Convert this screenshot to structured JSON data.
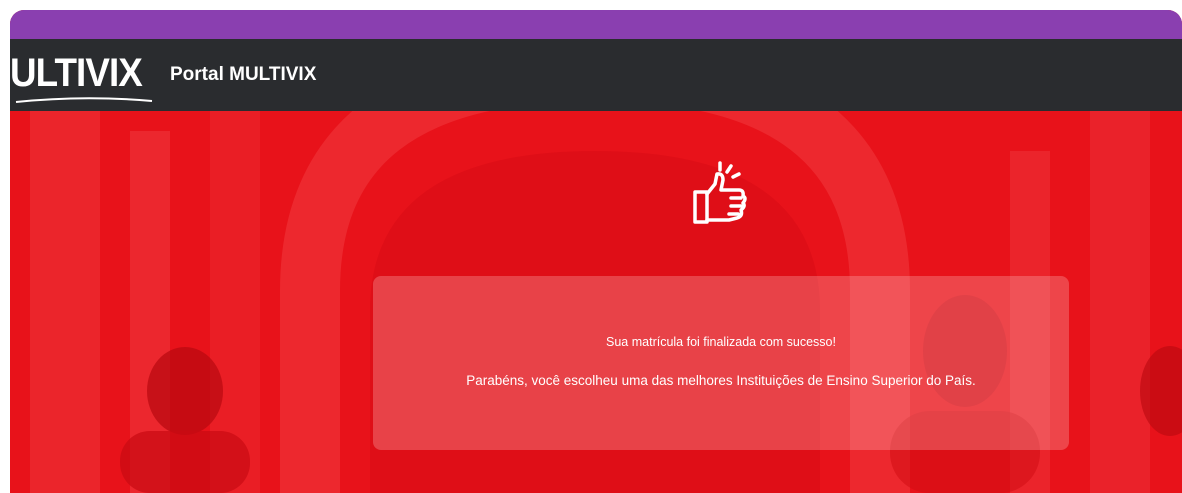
{
  "header": {
    "logo_text": "ULTIVIX",
    "title": "Portal MULTIVIX"
  },
  "success": {
    "icon": "thumbs-up-icon",
    "message": "Sua matrícula foi finalizada com sucesso!",
    "congrats": "Parabéns, você escolheu uma das melhores Instituições de Ensino Superior do País."
  },
  "colors": {
    "accent_stripe": "#8a3fb0",
    "header_bg": "#2a2c2f",
    "hero_overlay": "#e30e16"
  }
}
